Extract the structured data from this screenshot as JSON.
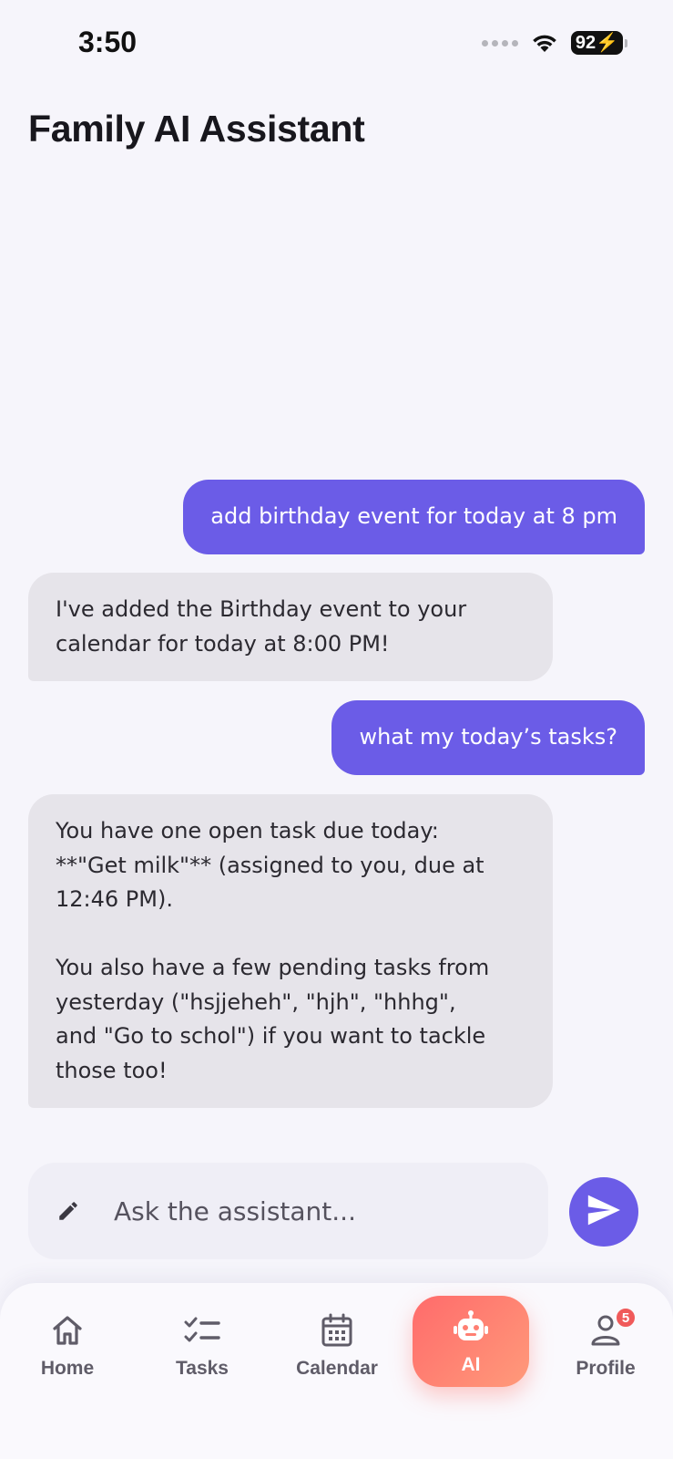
{
  "status_bar": {
    "time": "3:50",
    "battery": "92"
  },
  "header": {
    "title": "Family AI Assistant"
  },
  "messages": [
    {
      "role": "user",
      "text": "add birthday event for today at 8 pm"
    },
    {
      "role": "assistant",
      "text": "I've added the Birthday event to your\ncalendar for today at 8:00 PM!"
    },
    {
      "role": "user",
      "text": "what my today’s tasks?"
    },
    {
      "role": "assistant",
      "text": "You have one open task due today:\n**\"Get milk\"** (assigned to you, due at\n12:46 PM).\n\nYou also have a few pending tasks from\nyesterday (\"hsjjeheh\", \"hjh\", \"hhhg\",\nand \"Go to schol\") if you want to tackle\nthose too!"
    }
  ],
  "composer": {
    "placeholder": "Ask the assistant...",
    "value": ""
  },
  "nav": {
    "items": [
      {
        "label": "Home",
        "icon": "home-icon"
      },
      {
        "label": "Tasks",
        "icon": "tasks-icon"
      },
      {
        "label": "Calendar",
        "icon": "calendar-icon"
      },
      {
        "label": "AI",
        "icon": "robot-icon",
        "active": true
      },
      {
        "label": "Profile",
        "icon": "person-icon",
        "badge": "5"
      }
    ]
  },
  "colors": {
    "accent": "#6b5ce7",
    "assistant_bubble": "#e6e4ea",
    "active_tab_start": "#ff6b6b",
    "active_tab_end": "#ff9a7a",
    "badge": "#f05a5a",
    "background": "#f6f5fb"
  }
}
